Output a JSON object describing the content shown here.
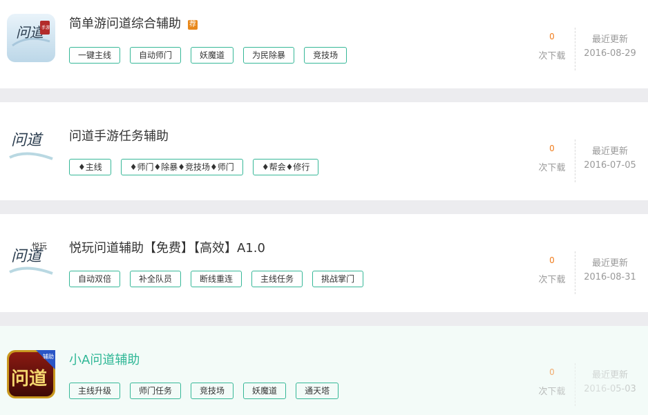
{
  "items": [
    {
      "title": "简单游问道综合辅助",
      "badge": "荐",
      "tags": [
        "一键主线",
        "自动师门",
        "妖魔道",
        "为民除暴",
        "竞技场"
      ],
      "downloads": "0",
      "downloads_label": "次下载",
      "update_label": "最近更新",
      "update_date": "2016-08-29",
      "icon_text": "问道",
      "icon_subtext": "手游"
    },
    {
      "title": "问道手游任务辅助",
      "tags": [
        "♦主线",
        "♦师门♦除暴♦竞技场♦师门",
        "♦帮会♦修行"
      ],
      "downloads": "0",
      "downloads_label": "次下载",
      "update_label": "最近更新",
      "update_date": "2016-07-05",
      "icon_text": "问道"
    },
    {
      "title": "悦玩问道辅助【免费】【高效】A1.0",
      "tags": [
        "自动双倍",
        "补全队员",
        "断线重连",
        "主线任务",
        "挑战掌门"
      ],
      "downloads": "0",
      "downloads_label": "次下载",
      "update_label": "最近更新",
      "update_date": "2016-08-31",
      "icon_text": "问道",
      "icon_subtext": "悦玩"
    },
    {
      "title": "小A问道辅助",
      "tags": [
        "主线升级",
        "师门任务",
        "竞技场",
        "妖魔道",
        "通天塔"
      ],
      "downloads": "0",
      "downloads_label": "次下载",
      "update_label": "最近更新",
      "update_date": "2016-05-03",
      "icon_text": "问道",
      "icon_subtext": "辅助"
    }
  ],
  "colors": {
    "accent": "#35b797",
    "badge": "#e8881b",
    "count": "#f07c1c",
    "muted": "#999999",
    "highlight_bg": "#f3fbf8"
  }
}
